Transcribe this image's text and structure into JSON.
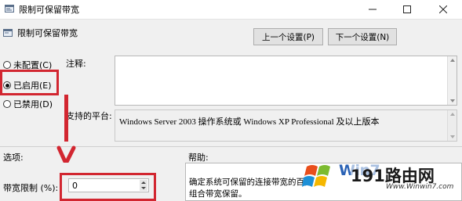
{
  "window": {
    "title": "限制可保留带宽"
  },
  "header": {
    "title": "限制可保留带宽"
  },
  "nav": {
    "prev_label": "上一个设置(P)",
    "next_label": "下一个设置(N)"
  },
  "radios": [
    {
      "label": "未配置(C)",
      "checked": false
    },
    {
      "label": "已启用(E)",
      "checked": true
    },
    {
      "label": "已禁用(D)",
      "checked": false
    }
  ],
  "comment": {
    "label": "注释:",
    "value": ""
  },
  "supported": {
    "label": "支持的平台:",
    "value": "Windows Server 2003 操作系统或 Windows XP Professional 及以上版本"
  },
  "options": {
    "label": "选项:",
    "bandwidth_label": "带宽限制 (%):",
    "bandwidth_value": "0"
  },
  "help": {
    "label": "帮助:",
    "line1": "确定系统可保留的连接带宽的百分",
    "line2": "组合带宽保留。"
  },
  "watermark": {
    "brand1": "191路由网",
    "url": "Www.Winwin7.com",
    "brand2": "Win7"
  },
  "colors": {
    "highlight": "#d22630"
  }
}
